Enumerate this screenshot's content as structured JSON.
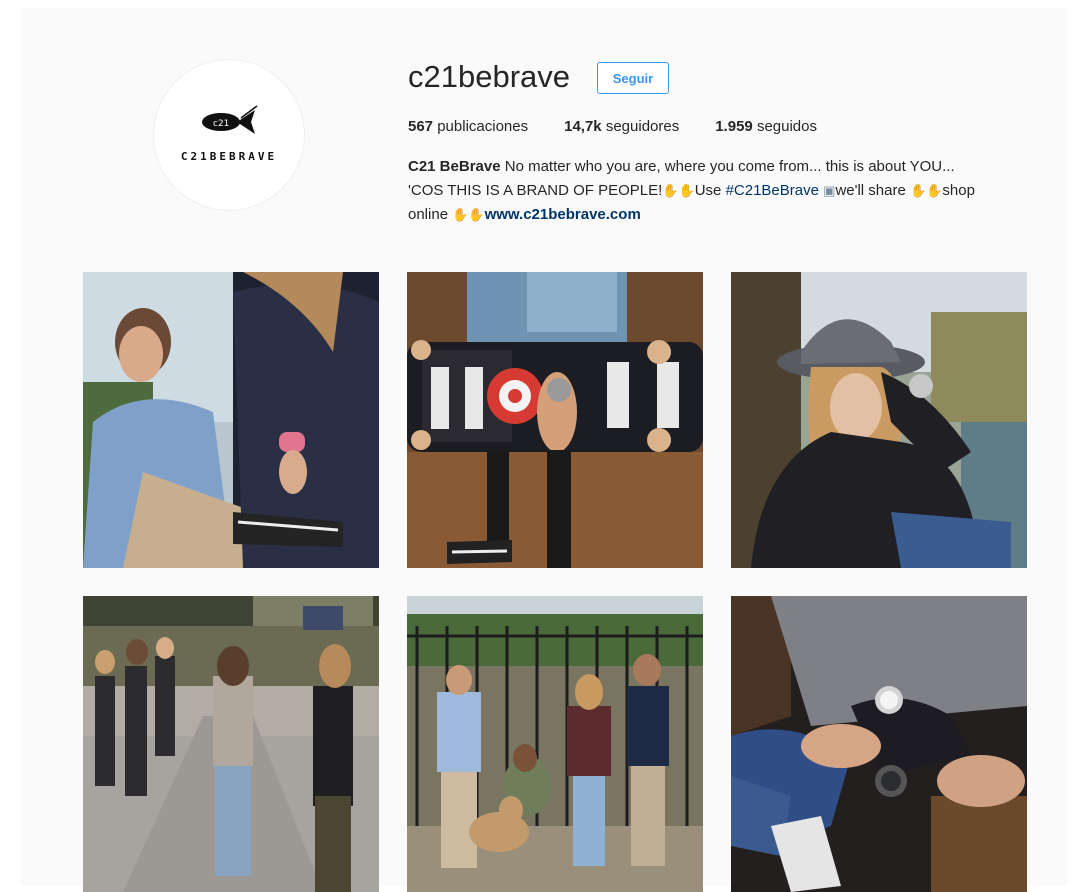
{
  "profile": {
    "username": "c21bebrave",
    "follow_label": "Seguir",
    "avatar_text": "C21BEBRAVE",
    "stats": {
      "posts_count": "567",
      "posts_label": "publicaciones",
      "followers_count": "14,7k",
      "followers_label": "seguidores",
      "following_count": "1.959",
      "following_label": "seguidos"
    },
    "bio": {
      "name": "C21 BeBrave",
      "line1_text": "No matter who you are, where you come from... this is about YOU...",
      "line2_text": "'COS THIS IS A BRAND OF PEOPLE!",
      "use_text": "Use",
      "hashtag": "#C21BeBrave",
      "share_text": "we'll share",
      "shop_text": "shop",
      "online_text": "online",
      "website": "www.c21bebrave.com",
      "emoji_icons": [
        "hands-emoji",
        "camera-emoji",
        "pointing-down-emoji"
      ]
    }
  },
  "posts": [
    {
      "id": "post-1"
    },
    {
      "id": "post-2"
    },
    {
      "id": "post-3"
    },
    {
      "id": "post-4"
    },
    {
      "id": "post-5"
    },
    {
      "id": "post-6"
    }
  ],
  "colors": {
    "follow_blue": "#3897f0",
    "link_navy": "#003569",
    "page_bg": "#fafafa"
  }
}
